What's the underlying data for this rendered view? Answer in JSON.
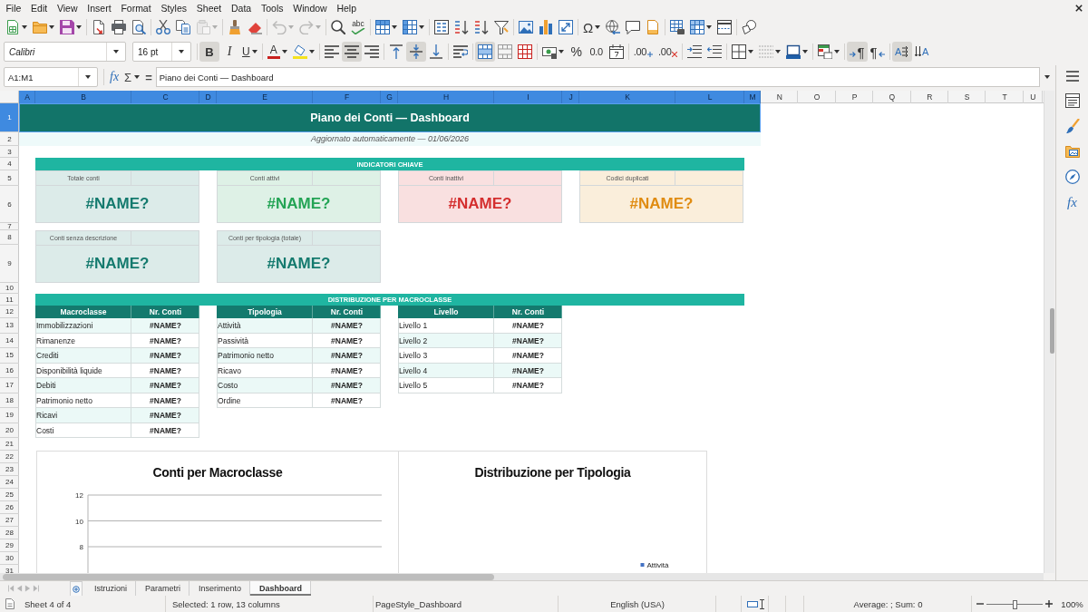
{
  "menu": [
    "File",
    "Edit",
    "View",
    "Insert",
    "Format",
    "Styles",
    "Sheet",
    "Data",
    "Tools",
    "Window",
    "Help"
  ],
  "toolbar_standard": [
    {
      "disabled": false
    },
    {
      "disabled": false
    },
    {
      "disabled": false
    },
    {
      "disabled": false
    },
    {
      "disabled": false
    },
    {
      "disabled": false
    },
    {
      "disabled": false
    },
    {
      "disabled": false
    },
    {
      "disabled": true
    },
    {
      "disabled": false
    },
    {
      "disabled": false
    },
    {
      "disabled": true
    },
    {
      "disabled": true
    },
    {
      "disabled": false
    },
    {
      "glyph": "abc",
      "disabled": false
    },
    {
      "disabled": false
    },
    {
      "disabled": false
    },
    {
      "disabled": false
    },
    {
      "disabled": false
    },
    {
      "disabled": false
    },
    {
      "disabled": false
    },
    {
      "disabled": false
    },
    {
      "disabled": false
    },
    {
      "disabled": false
    },
    {
      "glyph": "Ω",
      "disabled": false
    },
    {
      "disabled": false
    },
    {
      "disabled": false
    },
    {
      "disabled": false
    },
    {
      "disabled": false
    },
    {
      "disabled": false
    },
    {
      "disabled": false
    },
    {
      "disabled": false
    }
  ],
  "toolbar_formatting": {
    "font_name": "Calibri",
    "font_size": "16 pt",
    "buttons": [
      {
        "glyph": "B",
        "on": true
      },
      {
        "glyph": "I",
        "on": false
      },
      {
        "glyph": "U",
        "on": false
      },
      {
        "glyph": "A",
        "on": false
      },
      {
        "on": false
      },
      {
        "on": false
      },
      {
        "on": true
      },
      {
        "on": false
      },
      {
        "on": false
      },
      {
        "on": true
      },
      {
        "on": false
      },
      {
        "on": false
      },
      {
        "on": true
      },
      {
        "on": false
      },
      {
        "on": false
      },
      {
        "on": false
      },
      {
        "glyph": "%",
        "on": false
      },
      {
        "glyph": "0.0",
        "on": false
      },
      {
        "on": false
      },
      {
        "glyph": ".00",
        "on": false
      },
      {
        "glyph": ".00",
        "on": false
      },
      {
        "on": false
      },
      {
        "on": false
      },
      {
        "on": false
      },
      {
        "on": false
      },
      {
        "on": false
      },
      {
        "on": false
      },
      {
        "glyph": "¶",
        "on": true
      },
      {
        "glyph": "¶",
        "on": false
      },
      {
        "glyph": "A",
        "on": true
      },
      {
        "glyph": "A",
        "on": false
      }
    ]
  },
  "formula_bar": {
    "name_box": "A1:M1",
    "buttons": [
      "fx",
      "Σ",
      "="
    ],
    "content": "Piano dei Conti — Dashboard"
  },
  "sheet": {
    "columns": [
      {
        "label": "A",
        "selected": true
      },
      {
        "label": "B",
        "selected": true
      },
      {
        "label": "C",
        "selected": true
      },
      {
        "label": "D",
        "selected": true
      },
      {
        "label": "E",
        "selected": true
      },
      {
        "label": "F",
        "selected": true
      },
      {
        "label": "G",
        "selected": true
      },
      {
        "label": "H",
        "selected": true
      },
      {
        "label": "I",
        "selected": true
      },
      {
        "label": "J",
        "selected": true
      },
      {
        "label": "K",
        "selected": true
      },
      {
        "label": "L",
        "selected": true
      },
      {
        "label": "M",
        "selected": true
      },
      {
        "label": "N",
        "selected": false
      },
      {
        "label": "O",
        "selected": false
      },
      {
        "label": "P",
        "selected": false
      },
      {
        "label": "Q",
        "selected": false
      },
      {
        "label": "R",
        "selected": false
      },
      {
        "label": "S",
        "selected": false
      },
      {
        "label": "T",
        "selected": false
      },
      {
        "label": "U",
        "selected": false
      }
    ],
    "rows": [
      {
        "label": "1",
        "selected": true
      },
      {
        "label": "2",
        "selected": false
      },
      {
        "label": "3",
        "selected": false
      },
      {
        "label": "4",
        "selected": false
      },
      {
        "label": "5",
        "selected": false
      },
      {
        "label": "6",
        "selected": false
      },
      {
        "label": "7",
        "selected": false
      },
      {
        "label": "8",
        "selected": false
      },
      {
        "label": "9",
        "selected": false
      },
      {
        "label": "10",
        "selected": false
      },
      {
        "label": "11",
        "selected": false
      },
      {
        "label": "12",
        "selected": false
      },
      {
        "label": "13",
        "selected": false
      },
      {
        "label": "14",
        "selected": false
      },
      {
        "label": "15",
        "selected": false
      },
      {
        "label": "16",
        "selected": false
      },
      {
        "label": "17",
        "selected": false
      },
      {
        "label": "18",
        "selected": false
      },
      {
        "label": "19",
        "selected": false
      },
      {
        "label": "20",
        "selected": false
      },
      {
        "label": "21",
        "selected": false
      },
      {
        "label": "22",
        "selected": false
      },
      {
        "label": "23",
        "selected": false
      },
      {
        "label": "24",
        "selected": false
      },
      {
        "label": "25",
        "selected": false
      },
      {
        "label": "26",
        "selected": false
      },
      {
        "label": "27",
        "selected": false
      },
      {
        "label": "28",
        "selected": false
      },
      {
        "label": "29",
        "selected": false
      },
      {
        "label": "30",
        "selected": false
      },
      {
        "label": "31",
        "selected": false
      }
    ],
    "title": "Piano dei Conti — Dashboard",
    "subtitle": "Aggiornato automaticamente — 01/06/2026",
    "kpi_heading": "INDICATORI CHIAVE",
    "kpis": [
      {
        "label": "Totale conti",
        "value": "#NAME?",
        "color": "#147a6e"
      },
      {
        "label": "Conti attivi",
        "value": "#NAME?",
        "color": "#23a455"
      },
      {
        "label": "Conti inattivi",
        "value": "#NAME?",
        "color": "#d42e2e"
      },
      {
        "label": "Codici duplicati",
        "value": "#NAME?",
        "color": "#e08c12"
      },
      {
        "label": "Conti senza descrizione",
        "value": "#NAME?",
        "color": "#147a6e"
      },
      {
        "label": "Conti per tipologia (totale)",
        "value": "#NAME?",
        "color": "#147a6e"
      }
    ],
    "distribution_heading": "DISTRIBUZIONE PER MACROCLASSE",
    "tables": [
      {
        "columns": [
          "Macroclasse",
          "Nr. Conti"
        ],
        "rows": [
          {
            "cells": [
              "Immobilizzazioni",
              "#NAME?"
            ],
            "shaded": true
          },
          {
            "cells": [
              "Rimanenze",
              "#NAME?"
            ],
            "shaded": false
          },
          {
            "cells": [
              "Crediti",
              "#NAME?"
            ],
            "shaded": true
          },
          {
            "cells": [
              "Disponibilità liquide",
              "#NAME?"
            ],
            "shaded": false
          },
          {
            "cells": [
              "Debiti",
              "#NAME?"
            ],
            "shaded": true
          },
          {
            "cells": [
              "Patrimonio netto",
              "#NAME?"
            ],
            "shaded": false
          },
          {
            "cells": [
              "Ricavi",
              "#NAME?"
            ],
            "shaded": true
          },
          {
            "cells": [
              "Costi",
              "#NAME?"
            ],
            "shaded": false
          }
        ]
      },
      {
        "columns": [
          "Tipologia",
          "Nr. Conti"
        ],
        "rows": [
          {
            "cells": [
              "Attività",
              "#NAME?"
            ],
            "shaded": true
          },
          {
            "cells": [
              "Passività",
              "#NAME?"
            ],
            "shaded": false
          },
          {
            "cells": [
              "Patrimonio netto",
              "#NAME?"
            ],
            "shaded": true
          },
          {
            "cells": [
              "Ricavo",
              "#NAME?"
            ],
            "shaded": false
          },
          {
            "cells": [
              "Costo",
              "#NAME?"
            ],
            "shaded": true
          },
          {
            "cells": [
              "Ordine",
              "#NAME?"
            ],
            "shaded": false
          }
        ]
      },
      {
        "columns": [
          "Livello",
          "Nr. Conti"
        ],
        "rows": [
          {
            "cells": [
              "Livello 1",
              "#NAME?"
            ],
            "shaded": false
          },
          {
            "cells": [
              "Livello 2",
              "#NAME?"
            ],
            "shaded": true
          },
          {
            "cells": [
              "Livello 3",
              "#NAME?"
            ],
            "shaded": false
          },
          {
            "cells": [
              "Livello 4",
              "#NAME?"
            ],
            "shaded": true
          },
          {
            "cells": [
              "Livello 5",
              "#NAME?"
            ],
            "shaded": false
          }
        ]
      }
    ],
    "charts": [
      {
        "kind": "column",
        "title": "Conti per Macroclasse",
        "y_axis_labels": [
          "12",
          "10",
          "8"
        ]
      },
      {
        "kind": "pie",
        "title": "Distribuzione per Tipologia",
        "legend": [
          {
            "label": "Attività",
            "color": "#4472c4"
          }
        ]
      }
    ]
  },
  "sidebar": {
    "functions_button": "fx"
  },
  "sheet_tabs": [
    {
      "label": "Istruzioni",
      "selected": false
    },
    {
      "label": "Parametri",
      "selected": false
    },
    {
      "label": "Inserimento",
      "selected": false
    },
    {
      "label": "Dashboard",
      "selected": true
    }
  ],
  "status_bar": {
    "sheet": "Sheet 4 of 4",
    "selection": "Selected: 1 row, 13 columns",
    "page_style": "PageStyle_Dashboard",
    "language": "English (USA)",
    "summary": "Average: ; Sum: 0",
    "zoom": {
      "level": 0.5,
      "reading": "100%"
    }
  }
}
